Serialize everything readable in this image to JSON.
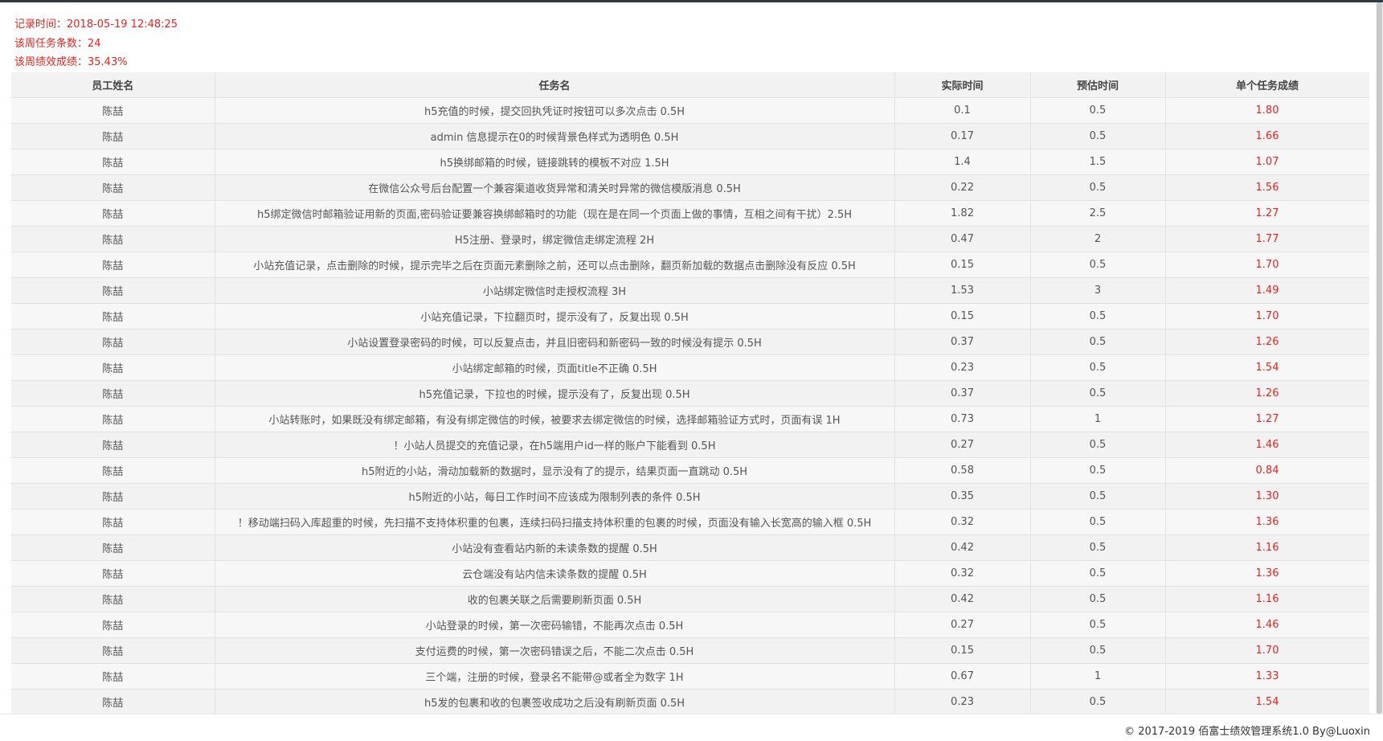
{
  "summary": {
    "record_time": "记录时间：2018-05-19 12:48:25",
    "task_count": "该周任务条数：24",
    "performance": "该周绩效成绩：35.43%"
  },
  "table": {
    "headers": [
      "员工姓名",
      "任务名",
      "实际时间",
      "预估时间",
      "单个任务成绩"
    ],
    "rows": [
      [
        "陈喆",
        "h5充值的时候，提交回执凭证时按钮可以多次点击 0.5H",
        "0.1",
        "0.5",
        "1.80"
      ],
      [
        "陈喆",
        "admin 信息提示在0的时候背景色样式为透明色 0.5H",
        "0.17",
        "0.5",
        "1.66"
      ],
      [
        "陈喆",
        "h5换绑邮箱的时候，链接跳转的模板不对应 1.5H",
        "1.4",
        "1.5",
        "1.07"
      ],
      [
        "陈喆",
        "在微信公众号后台配置一个兼容渠道收货异常和清关时异常的微信模版消息 0.5H",
        "0.22",
        "0.5",
        "1.56"
      ],
      [
        "陈喆",
        "h5绑定微信时邮箱验证用新的页面,密码验证要兼容换绑邮箱时的功能（现在是在同一个页面上做的事情，互相之间有干扰）2.5H",
        "1.82",
        "2.5",
        "1.27"
      ],
      [
        "陈喆",
        "H5注册、登录时，绑定微信走绑定流程 2H",
        "0.47",
        "2",
        "1.77"
      ],
      [
        "陈喆",
        "小站充值记录，点击删除的时候，提示完毕之后在页面元素删除之前，还可以点击删除，翻页新加载的数据点击删除没有反应 0.5H",
        "0.15",
        "0.5",
        "1.70"
      ],
      [
        "陈喆",
        "小站绑定微信时走授权流程 3H",
        "1.53",
        "3",
        "1.49"
      ],
      [
        "陈喆",
        "小站充值记录，下拉翻页时，提示没有了，反复出现 0.5H",
        "0.15",
        "0.5",
        "1.70"
      ],
      [
        "陈喆",
        "小站设置登录密码的时候，可以反复点击，并且旧密码和新密码一致的时候没有提示 0.5H",
        "0.37",
        "0.5",
        "1.26"
      ],
      [
        "陈喆",
        "小站绑定邮箱的时候，页面title不正确 0.5H",
        "0.23",
        "0.5",
        "1.54"
      ],
      [
        "陈喆",
        "h5充值记录，下拉也的时候，提示没有了，反复出现 0.5H",
        "0.37",
        "0.5",
        "1.26"
      ],
      [
        "陈喆",
        "小站转账时，如果既没有绑定邮箱，有没有绑定微信的时候，被要求去绑定微信的时候，选择邮箱验证方式时，页面有误 1H",
        "0.73",
        "1",
        "1.27"
      ],
      [
        "陈喆",
        "！小站人员提交的充值记录，在h5端用户id一样的账户下能看到 0.5H",
        "0.27",
        "0.5",
        "1.46"
      ],
      [
        "陈喆",
        "h5附近的小站，滑动加载新的数据时，显示没有了的提示，结果页面一直跳动 0.5H",
        "0.58",
        "0.5",
        "0.84"
      ],
      [
        "陈喆",
        "h5附近的小站，每日工作时间不应该成为限制列表的条件 0.5H",
        "0.35",
        "0.5",
        "1.30"
      ],
      [
        "陈喆",
        "！移动端扫码入库超重的时候，先扫描不支持体积重的包裹，连续扫码扫描支持体积重的包裹的时候，页面没有输入长宽高的输入框 0.5H",
        "0.32",
        "0.5",
        "1.36"
      ],
      [
        "陈喆",
        "小站没有查看站内新的未读条数的提醒 0.5H",
        "0.42",
        "0.5",
        "1.16"
      ],
      [
        "陈喆",
        "云仓端没有站内信未读条数的提醒 0.5H",
        "0.32",
        "0.5",
        "1.36"
      ],
      [
        "陈喆",
        "收的包裹关联之后需要刷新页面 0.5H",
        "0.42",
        "0.5",
        "1.16"
      ],
      [
        "陈喆",
        "小站登录的时候，第一次密码输错，不能再次点击 0.5H",
        "0.27",
        "0.5",
        "1.46"
      ],
      [
        "陈喆",
        "支付运费的时候，第一次密码错误之后，不能二次点击 0.5H",
        "0.15",
        "0.5",
        "1.70"
      ],
      [
        "陈喆",
        "三个端，注册的时候，登录名不能带@或者全为数字 1H",
        "0.67",
        "1",
        "1.33"
      ],
      [
        "陈喆",
        "h5发的包裹和收的包裹签收成功之后没有刷新页面 0.5H",
        "0.23",
        "0.5",
        "1.54"
      ]
    ]
  },
  "footer": {
    "copyright": "© 2017-2019 佰富士绩效管理系统1.0 By@Luoxin"
  },
  "colors": {
    "accent_red": "#e8231f",
    "topbar": "#2f3a43"
  }
}
